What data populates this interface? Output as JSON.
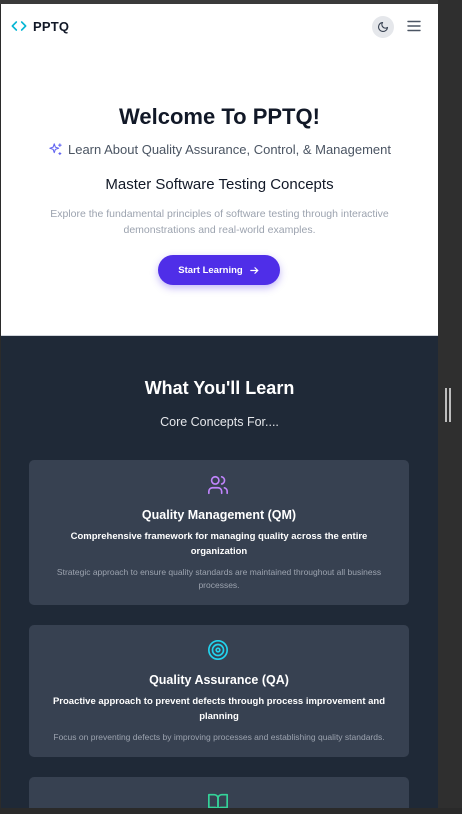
{
  "header": {
    "brand": "PPTQ",
    "icons": {
      "logo": "code-brackets-icon",
      "theme": "moon-icon",
      "menu": "hamburger-menu-icon"
    }
  },
  "hero": {
    "title": "Welcome To PPTQ!",
    "tagline": "Learn About Quality Assurance, Control, & Management",
    "subtitle": "Master Software Testing Concepts",
    "description": "Explore the fundamental principles of software testing through interactive demonstrations and real-world examples.",
    "cta_label": "Start Learning"
  },
  "learn": {
    "title": "What You'll Learn",
    "subtitle": "Core Concepts For....",
    "cards": [
      {
        "icon": "users-icon",
        "title": "Quality Management (QM)",
        "lead": "Comprehensive framework for managing quality across the entire organization",
        "detail": "Strategic approach to ensure quality standards are maintained throughout all business processes."
      },
      {
        "icon": "target-icon",
        "title": "Quality Assurance (QA)",
        "lead": "Proactive approach to prevent defects through process improvement and planning",
        "detail": "Focus on preventing defects by improving processes and establishing quality standards."
      },
      {
        "icon": "book-open-icon"
      }
    ]
  },
  "colors": {
    "accent": "#4f2ee8",
    "logo": "#06b6d4",
    "dark_bg": "#1f2937",
    "card_bg": "#374151",
    "icon_purple": "#c084fc",
    "icon_cyan": "#22d3ee",
    "icon_green": "#34d399"
  }
}
